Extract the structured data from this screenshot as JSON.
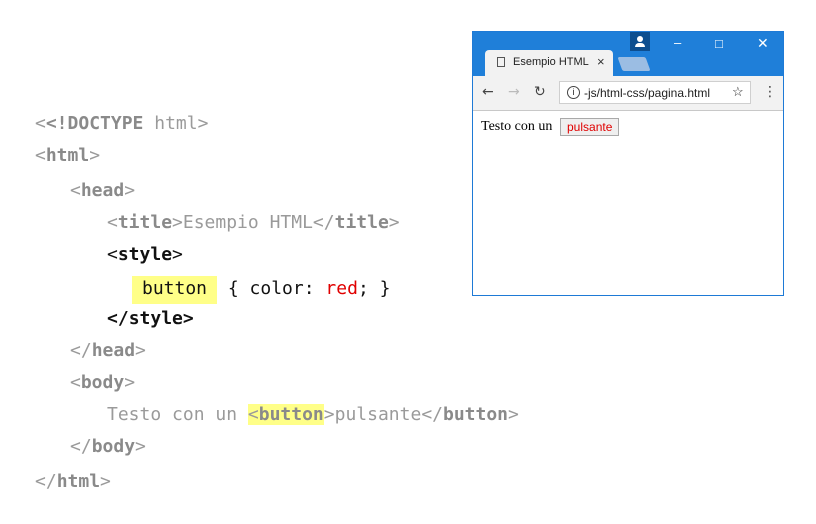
{
  "code": {
    "doctype_bang": "<!DOCTYPE",
    "doctype_rest": " html>",
    "html_open": "html",
    "head_open": "head",
    "title_tag": "title",
    "title_text": "Esempio HTML",
    "style_tag": "style",
    "css_selector": "button",
    "css_property": "{ color: ",
    "css_value": "red",
    "css_end": "; }",
    "head_close": "head",
    "body_open": "body",
    "body_text": "Testo con un ",
    "button_tag": "button",
    "button_text": "pulsante",
    "body_close": "body",
    "html_close": "html"
  },
  "browser": {
    "tab_title": "Esempio HTML",
    "tab_close": "×",
    "url": "-js/html-css/pagina.html",
    "page_text": "Testo con un",
    "button_label": "pulsante",
    "button_color": "#e00000",
    "titlebar_color": "#1f7fd9"
  },
  "highlight_color": "#ffff88"
}
